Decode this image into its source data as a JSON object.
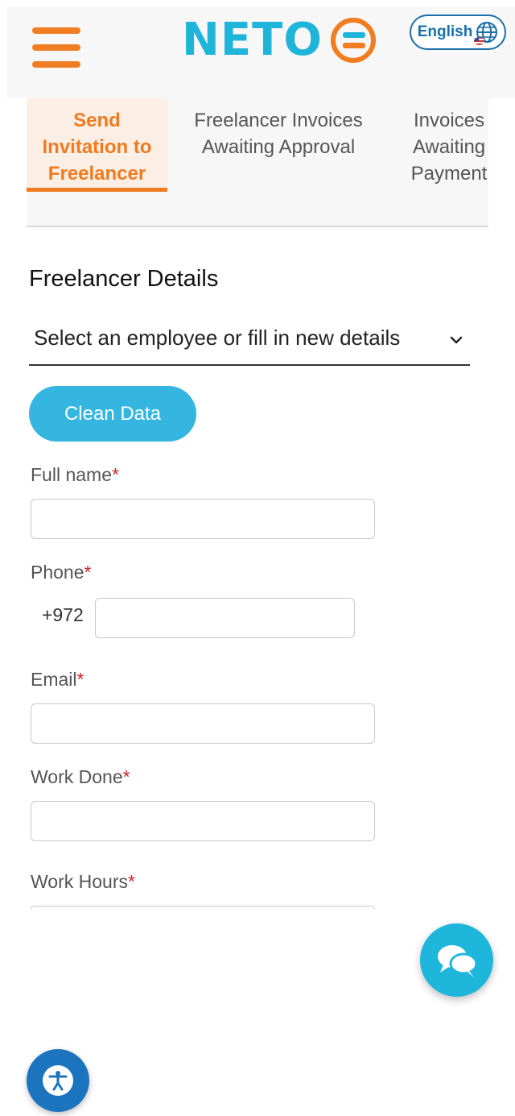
{
  "header": {
    "logo_text": "NETO",
    "language_label": "English"
  },
  "tabs": [
    {
      "label": "Send\nInvitation to\nFreelancer",
      "active": true
    },
    {
      "label": "Freelancer Invoices\nAwaiting Approval",
      "active": false
    },
    {
      "label": "Invoices\nAwaiting\nPayment",
      "active": false
    }
  ],
  "form": {
    "section_title": "Freelancer Details",
    "employee_select": "Select an employee or fill in new details",
    "clean_button": "Clean Data",
    "required_mark": "*",
    "full_name_label": "Full name",
    "full_name_value": "",
    "phone_label": "Phone",
    "phone_prefix": "+972",
    "phone_value": "",
    "email_label": "Email",
    "email_value": "",
    "work_done_label": "Work Done",
    "work_done_value": "",
    "work_hours_label": "Work Hours"
  },
  "icons": {
    "menu": "hamburger-menu-icon",
    "language": "globe-icon",
    "chat": "chat-bubbles-icon",
    "accessibility": "accessibility-icon"
  },
  "colors": {
    "brand_orange": "#f07d22",
    "brand_cyan": "#1fb4d9",
    "accessibility_blue": "#1c74bf",
    "required_red": "#d02525"
  }
}
